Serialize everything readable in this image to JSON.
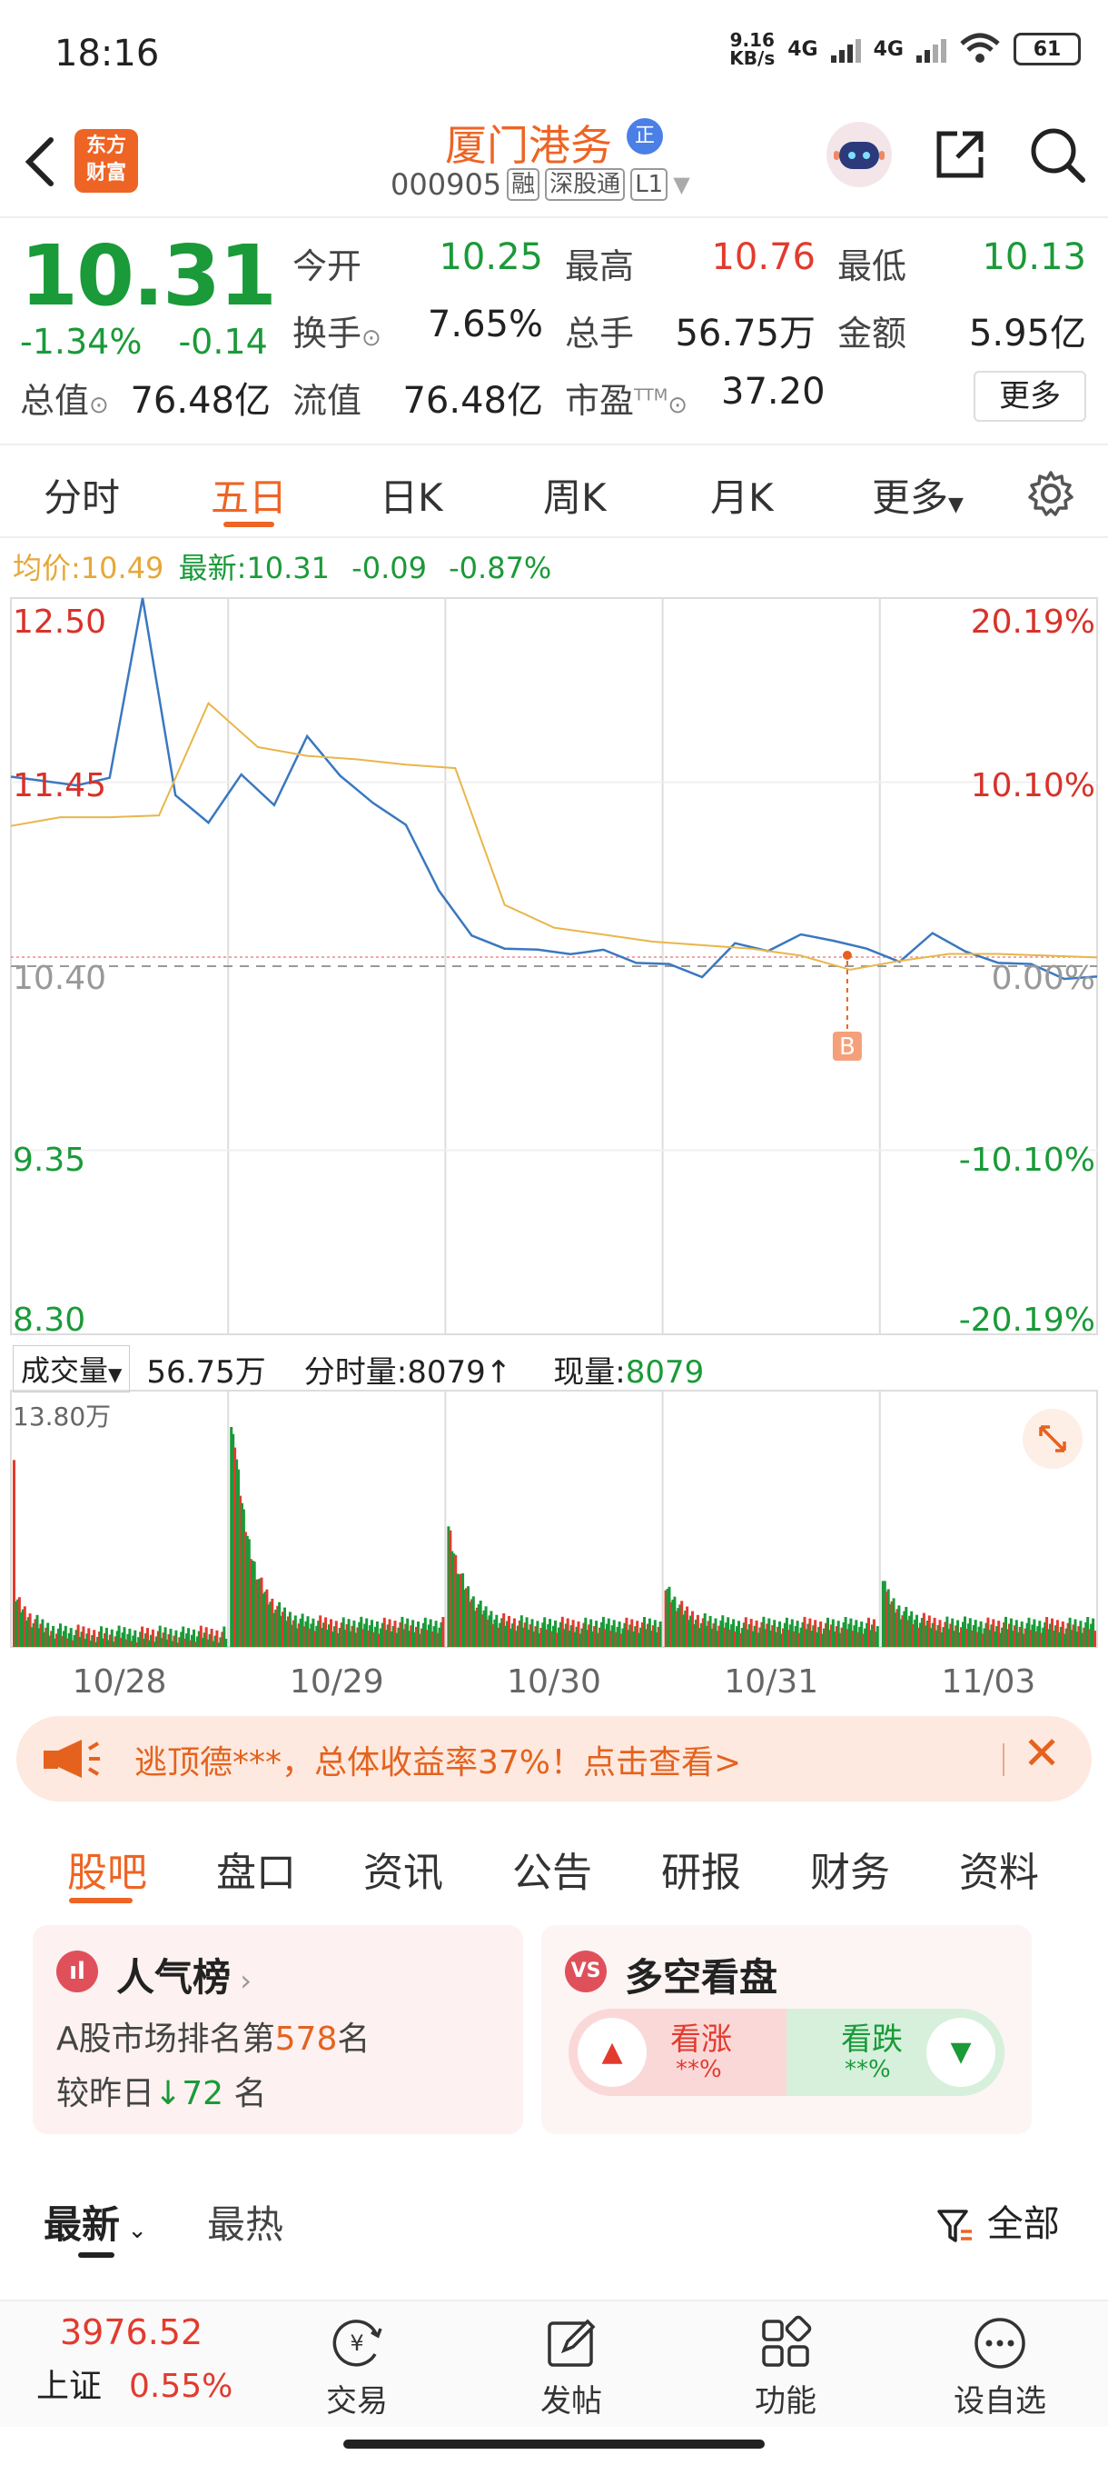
{
  "status_bar": {
    "time": "18:16",
    "net_speed_top": "9.16",
    "net_speed_unit": "KB/s",
    "net1": "4G",
    "net2": "4G",
    "battery": "61"
  },
  "header": {
    "logo_line1": "东方",
    "logo_line2": "财富",
    "stock_name": "厦门港务",
    "badge": "正",
    "code": "000905",
    "tags": [
      "融",
      "深股通",
      "L1"
    ]
  },
  "quote": {
    "price": "10.31",
    "change_pct": "-1.34%",
    "change": "-0.14",
    "open_label": "今开",
    "open": "10.25",
    "high_label": "最高",
    "high": "10.76",
    "low_label": "最低",
    "low": "10.13",
    "turnover_label": "换手",
    "turnover": "7.65%",
    "volume_label": "总手",
    "volume": "56.75万",
    "amount_label": "金额",
    "amount": "5.95亿",
    "mktcap_label": "总值",
    "mktcap": "76.48亿",
    "float_label": "流值",
    "float": "76.48亿",
    "pe_label": "市盈",
    "pe_sup": "TTM",
    "pe": "37.20",
    "more": "更多"
  },
  "tabs": [
    "分时",
    "五日",
    "日K",
    "周K",
    "月K",
    "更多"
  ],
  "active_tab": "五日",
  "avg_line": {
    "avg_label": "均价:",
    "avg": "10.49",
    "latest_label": "最新:",
    "latest": "10.31",
    "chg": "-0.09",
    "pct": "-0.87%"
  },
  "chart_data": {
    "type": "line",
    "x": [
      "10/28",
      "10/29",
      "10/30",
      "10/31",
      "11/03"
    ],
    "left_ticks": [
      "12.50",
      "11.45",
      "10.40",
      "9.35",
      "8.30"
    ],
    "right_ticks": [
      "20.19%",
      "10.10%",
      "0.00%",
      "-10.10%",
      "-20.19%"
    ],
    "ylim": [
      8.3,
      12.5
    ],
    "prev_close": 10.4,
    "marker": "B",
    "series": [
      {
        "values": [
          11.45,
          11.45,
          11.45,
          11.45,
          12.5,
          11.4,
          11.2,
          11.5,
          11.35,
          11.7,
          11.5,
          11.3,
          11.2,
          10.85,
          10.55,
          10.5,
          10.52,
          10.45,
          10.5,
          10.45,
          10.4,
          10.35,
          10.5,
          10.48,
          10.6,
          10.52,
          10.5,
          10.45,
          10.57,
          10.49,
          10.45,
          10.4,
          10.34,
          10.31
        ]
      },
      {
        "values": [
          11.2,
          11.25,
          11.25,
          11.26,
          11.9,
          11.65,
          11.6,
          11.58,
          11.55,
          11.53,
          10.75,
          10.62,
          10.58,
          10.54,
          10.52,
          10.5,
          10.46,
          10.38,
          10.43,
          10.47,
          10.47,
          10.46,
          10.45
        ]
      }
    ]
  },
  "volume": {
    "selector": "成交量",
    "total": "56.75万",
    "tick_label_text": "分时量:",
    "tick_value": "8079",
    "now_label": "现量:",
    "now_value": "8079",
    "max_label": "13.80万"
  },
  "ad": {
    "text": "逃顶德***，总体收益率37%！点击查看>"
  },
  "sub_tabs": [
    "股吧",
    "盘口",
    "资讯",
    "公告",
    "研报",
    "财务",
    "资料"
  ],
  "cards": {
    "popularity": {
      "title": "人气榜",
      "rank_prefix": "A股市场排名第",
      "rank": "578",
      "rank_suffix": "名",
      "change_prefix": "较昨日",
      "change": "72",
      "change_suffix": "名"
    },
    "sentiment": {
      "title": "多空看盘",
      "up": "看涨",
      "up_pct": "**%",
      "down": "看跌",
      "down_pct": "**%"
    }
  },
  "sort": {
    "latest": "最新",
    "hot": "最热",
    "filter": "全部"
  },
  "bottom": {
    "index_value": "3976.52",
    "index_name": "上证",
    "index_pct": "0.55%",
    "items": [
      "交易",
      "发帖",
      "功能",
      "设自选"
    ]
  }
}
